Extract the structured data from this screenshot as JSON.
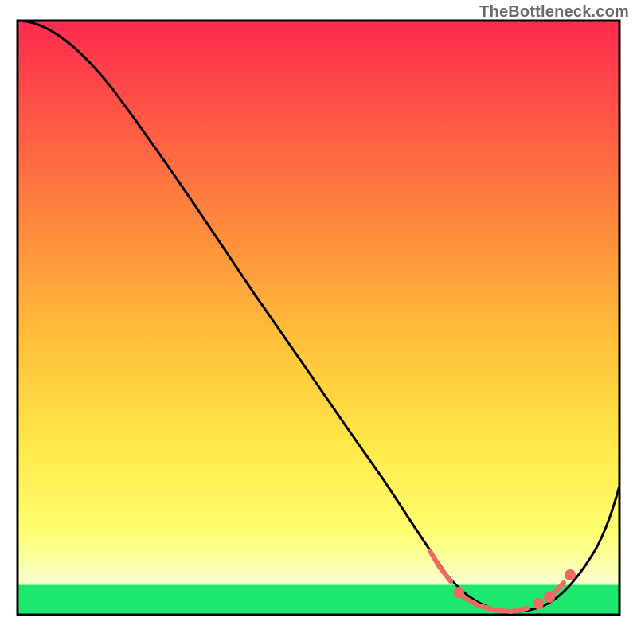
{
  "attribution": "TheBottleneck.com",
  "chart_data": {
    "type": "line",
    "title": "",
    "xlabel": "",
    "ylabel": "",
    "xlim": [
      0,
      100
    ],
    "ylim": [
      0,
      100
    ],
    "x": [
      0,
      2,
      6,
      10,
      15,
      20,
      25,
      30,
      35,
      40,
      45,
      50,
      55,
      60,
      65,
      68,
      70,
      72,
      75,
      78,
      80,
      82,
      84,
      86,
      88,
      90,
      93,
      96,
      100
    ],
    "values": [
      100,
      100,
      98,
      95,
      90,
      84,
      77,
      70,
      63,
      56,
      49,
      42,
      35,
      28,
      20,
      14,
      10,
      7,
      4,
      2,
      1,
      0.5,
      0.5,
      1,
      2,
      4,
      8,
      14,
      24
    ],
    "series": [
      {
        "name": "bottleneck-curve",
        "x": [
          0,
          2,
          6,
          10,
          15,
          20,
          25,
          30,
          35,
          40,
          45,
          50,
          55,
          60,
          65,
          68,
          70,
          72,
          75,
          78,
          80,
          82,
          84,
          86,
          88,
          90,
          93,
          96,
          100
        ],
        "values": [
          100,
          100,
          98,
          95,
          90,
          84,
          77,
          70,
          63,
          56,
          49,
          42,
          35,
          28,
          20,
          14,
          10,
          7,
          4,
          2,
          1,
          0.5,
          0.5,
          1,
          2,
          4,
          8,
          14,
          24
        ]
      }
    ],
    "highlight_points": {
      "name": "optimal-band",
      "color": "#ee6b65",
      "x": [
        69,
        70,
        71,
        73,
        75,
        77,
        79,
        81,
        83,
        85,
        87,
        89,
        90
      ],
      "values": [
        11,
        9,
        8,
        5,
        3.5,
        2.5,
        1.5,
        0.8,
        0.7,
        1.2,
        2.5,
        4,
        5
      ]
    },
    "background_gradient": {
      "top": "#ff2a4f",
      "mid_upper": "#ffb23a",
      "mid_lower": "#ffff5a",
      "bottom_band": "#1ee86e"
    },
    "frame_color": "#000000"
  }
}
